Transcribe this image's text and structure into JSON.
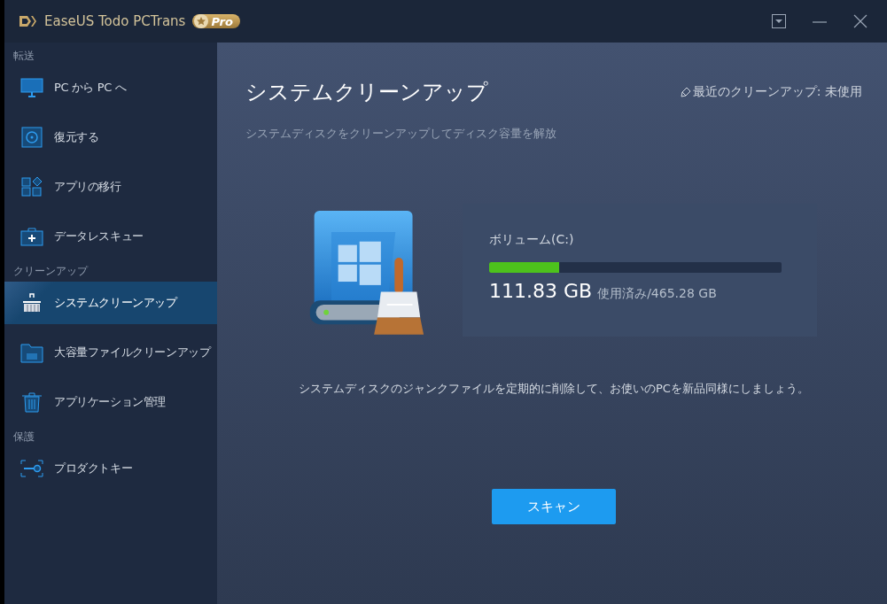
{
  "app": {
    "title": "EaseUS Todo PCTrans",
    "badge": "Pro"
  },
  "sidebar": {
    "sections": [
      {
        "heading": "転送",
        "items": [
          {
            "label": "PC から PC へ",
            "kind": "monitor",
            "selected": false
          },
          {
            "label": "復元する",
            "kind": "restore",
            "selected": false
          },
          {
            "label": "アプリの移行",
            "kind": "apps",
            "selected": false
          },
          {
            "label": "データレスキュー",
            "kind": "kit",
            "selected": false
          }
        ]
      },
      {
        "heading": "クリーンアップ",
        "items": [
          {
            "label": "システムクリーンアップ",
            "kind": "broom",
            "selected": true
          },
          {
            "label": "大容量ファイルクリーンアップ",
            "kind": "folder",
            "selected": false
          },
          {
            "label": "アプリケーション管理",
            "kind": "trash",
            "selected": false
          }
        ]
      },
      {
        "heading": "保護",
        "items": [
          {
            "label": "プロダクトキー",
            "kind": "key",
            "selected": false
          }
        ]
      }
    ]
  },
  "main": {
    "title": "システムクリーンアップ",
    "last_cleanup": "最近のクリーンアップ: 未使用",
    "subtitle": "システムディスクをクリーンアップしてディスク容量を解放",
    "volume": {
      "name": "ボリューム(C:)",
      "level": 0.24,
      "used": "111.83 GB",
      "total": "使用済み/465.28 GB"
    },
    "hint": "システムディスクのジャンクファイルを定期的に削除して、お使いのPCを新品同様にしましょう。",
    "button": "スキャン"
  }
}
